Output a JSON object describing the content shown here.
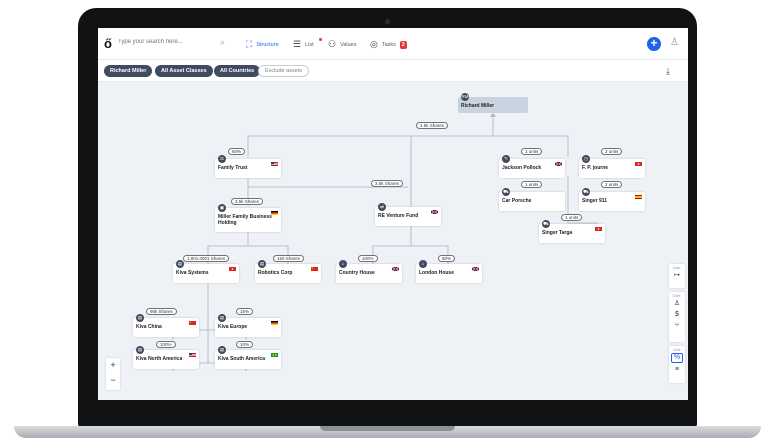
{
  "header": {
    "search_placeholder": "Type your search here...",
    "tabs": [
      {
        "label": "Structure",
        "icon": "hierarchy-icon",
        "active": true
      },
      {
        "label": "List",
        "icon": "list-icon",
        "active": false
      },
      {
        "label": "Values",
        "icon": "values-icon",
        "active": false
      },
      {
        "label": "Tasks",
        "icon": "check-circle-icon",
        "active": false,
        "badge": "2"
      }
    ],
    "accent_color": "#1e63e9"
  },
  "filters": {
    "chips": [
      "Richard Miller",
      "All Asset Classes",
      "All Countries"
    ],
    "exclude_label": "Exclude assets"
  },
  "tree": {
    "root": "Richard Miller",
    "nodes": {
      "family_trust": "Family Trust",
      "miller_holding": "Miller Family Business Holding",
      "re_venture": "RE Venture Fund",
      "jackson_pollock": "Jackson Pollock",
      "fp_journe": "F. P. journe",
      "car_porsche": "Car Porsche",
      "singer_911": "Singer 911",
      "singer_targa": "Singer Targa",
      "kiva_systems": "Kiva Systems",
      "robotics_corp": "Robotics Corp",
      "country_house": "Country House",
      "london_house": "London House",
      "kiva_china": "Kiva China",
      "kiva_europe": "Kiva Europe",
      "kiva_north_america": "Kiva North America",
      "kiva_south_america": "Kiva South America"
    },
    "pills": {
      "root_shares": "1.5k Shares",
      "family_trust": "60%",
      "re_shares": "3.5k Shares",
      "holding_shares": "2.5k Shares",
      "jackson_units": "1 units",
      "journe_units": "2 units",
      "porsche_units": "1 units",
      "singer911_units": "2 units",
      "targa_units": "1 units",
      "kiva_shares": "1,001.0001 Shares",
      "robotics_shares": "150 Shares",
      "country_pct": "100%",
      "london_pct": "50%",
      "china_shares": "95k Shares",
      "europe_pct": "15%",
      "na_pct": "100%",
      "sa_pct": "10%"
    }
  },
  "side_panel": {
    "calc_label": "Calc.",
    "cont_label": "Cont.",
    "line_label": "Line"
  }
}
